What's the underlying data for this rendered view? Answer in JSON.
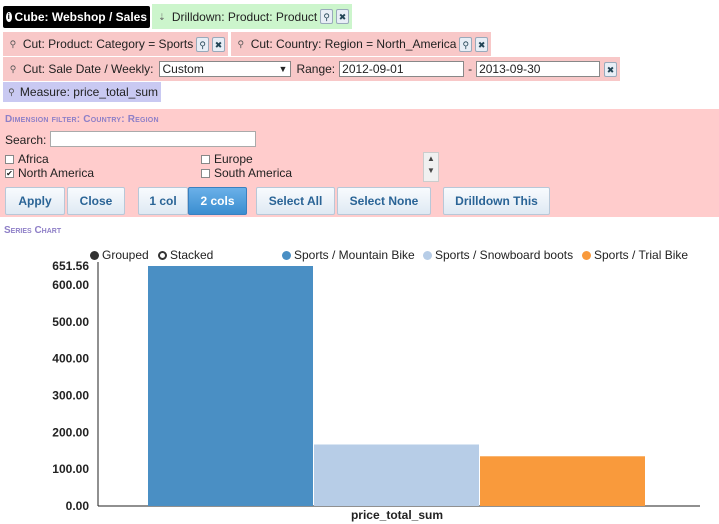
{
  "filters": {
    "cube_label": "Cube: Webshop / Sales",
    "drilldown_label": "Drilldown: Product: Product",
    "cut_category_label": "Cut: Product: Category = Sports",
    "cut_region_label": "Cut: Country: Region = North_America",
    "cut_date_label": "Cut: Sale Date / Weekly:",
    "date_mode_selected": "Custom",
    "range_label": "Range:",
    "range_from": "2012-09-01",
    "range_sep": "-",
    "range_to": "2013-09-30",
    "measure_label": "Measure: price_total_sum"
  },
  "dimension_filter": {
    "title": "Dimension filter: Country: Region",
    "search_label": "Search:",
    "search_value": "",
    "options": [
      {
        "label": "Africa",
        "checked": false
      },
      {
        "label": "Europe",
        "checked": false
      },
      {
        "label": "North America",
        "checked": true
      },
      {
        "label": "South America",
        "checked": false
      }
    ],
    "buttons": {
      "apply": "Apply",
      "close": "Close",
      "one_col": "1 col",
      "two_cols": "2 cols",
      "select_all": "Select All",
      "select_none": "Select None",
      "drilldown_this": "Drilldown This"
    }
  },
  "series_chart": {
    "title": "Series Chart",
    "mode_grouped": "Grouped",
    "mode_stacked": "Stacked",
    "selected_mode": "Grouped"
  },
  "chart_data": {
    "type": "bar",
    "categories": [
      "price_total_sum"
    ],
    "series": [
      {
        "name": "Sports / Mountain Bike",
        "values": [
          651.56
        ],
        "color": "#4a8fc4"
      },
      {
        "name": "Sports / Snowboard boots",
        "values": [
          167
        ],
        "color": "#b7cde7"
      },
      {
        "name": "Sports / Trial Bike",
        "values": [
          135
        ],
        "color": "#f99a3c"
      }
    ],
    "y_ticks": [
      "0.00",
      "100.00",
      "200.00",
      "300.00",
      "400.00",
      "500.00",
      "600.00",
      "651.56"
    ],
    "ylim": [
      0,
      651.56
    ],
    "legend_position": "top-right",
    "grid": false
  }
}
